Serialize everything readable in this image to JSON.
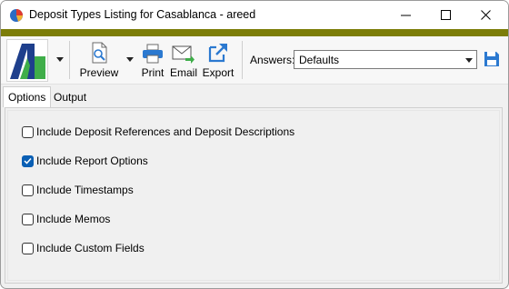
{
  "window": {
    "title": "Deposit Types Listing for Casablanca - areed",
    "accent_color": "#7c7d08"
  },
  "toolbar": {
    "logo_icon": "company-logo-icon",
    "preview_label": "Preview",
    "print_label": "Print",
    "email_label": "Email",
    "export_label": "Export",
    "answers_label": "Answers:",
    "answers_value": "Defaults"
  },
  "tabs": [
    {
      "label": "Options",
      "active": true
    },
    {
      "label": "Output",
      "active": false
    }
  ],
  "options": [
    {
      "label": "Include Deposit References and Deposit Descriptions",
      "checked": false
    },
    {
      "label": "Include Report Options",
      "checked": true
    },
    {
      "label": "Include Timestamps",
      "checked": false
    },
    {
      "label": "Include Memos",
      "checked": false
    },
    {
      "label": "Include Custom Fields",
      "checked": false
    }
  ]
}
